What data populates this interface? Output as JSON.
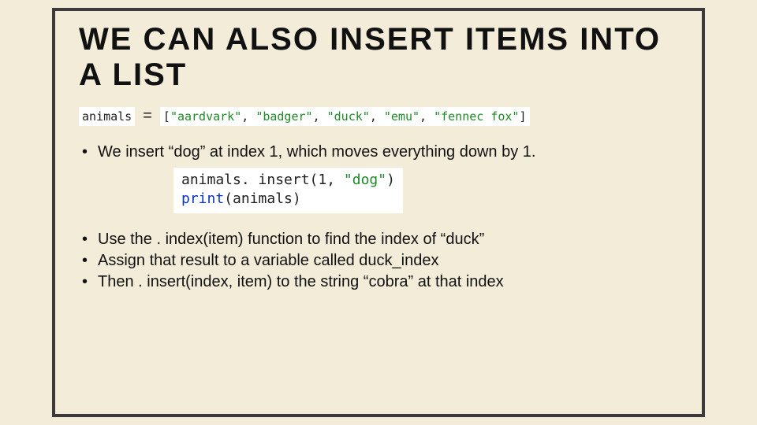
{
  "title": "WE CAN ALSO INSERT ITEMS INTO A LIST",
  "code_assign": {
    "var": "animals",
    "eq": "=",
    "list_open": "[",
    "items": [
      "\"aardvark\"",
      "\"badger\"",
      "\"duck\"",
      "\"emu\"",
      "\"fennec fox\"",
      "]"
    ],
    "sep": ", "
  },
  "bullet1": "We insert “dog”  at index 1, which moves everything down by 1.",
  "code_insert": {
    "line1_pre": "animals. insert(1, ",
    "line1_str": "\"dog\"",
    "line1_post": ")",
    "line2_fn": "print",
    "line2_args": "(animals)"
  },
  "bullets_tail": [
    "Use the  . index(item) function to find the index of  “duck”",
    "Assign that result to a variable called duck_index",
    "Then . insert(index, item) to the string “cobra” at that index"
  ]
}
